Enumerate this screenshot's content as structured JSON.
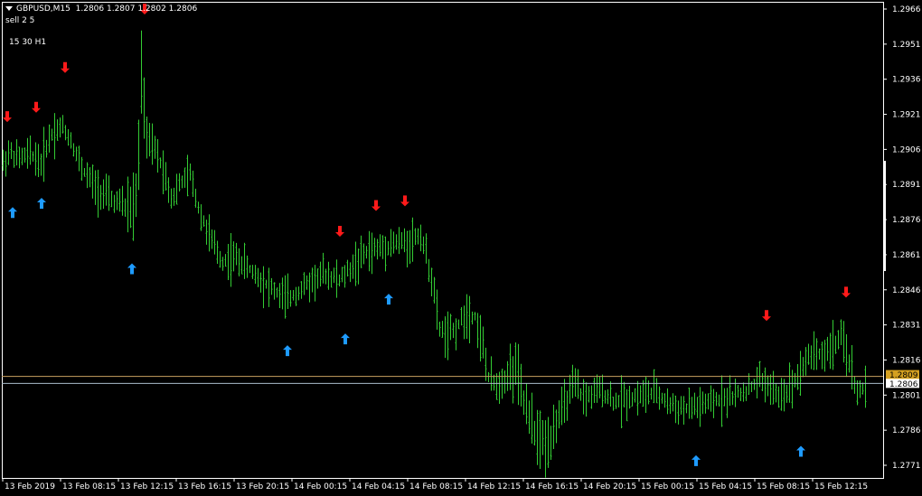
{
  "header": {
    "symbol_timeframe": "GBPUSD,M15",
    "ohlc": "1.2806 1.2807 1.2802 1.2806",
    "signal_label": "sell 2 5",
    "periods_label": "15 30 H1"
  },
  "colors": {
    "background": "#000000",
    "bars": "#33cc33",
    "buy_arrow": "#1e9bff",
    "sell_arrow": "#ff1a1a",
    "bid_line": "#aabbcc",
    "level_line": "#c8a060",
    "axis": "#ffffff"
  },
  "chart_data": {
    "type": "ohlc",
    "symbol": "GBPUSD",
    "timeframe": "M15",
    "ylim": [
      1.2765,
      1.2968
    ],
    "y_ticks": [
      "1.2966",
      "1.2951",
      "1.2936",
      "1.2921",
      "1.2906",
      "1.2891",
      "1.2876",
      "1.2861",
      "1.2846",
      "1.2831",
      "1.2816",
      "1.2801",
      "1.2786",
      "1.2771"
    ],
    "x_ticks": [
      "13 Feb 2019",
      "13 Feb 08:15",
      "13 Feb 12:15",
      "13 Feb 16:15",
      "13 Feb 20:15",
      "14 Feb 00:15",
      "14 Feb 04:15",
      "14 Feb 08:15",
      "14 Feb 12:15",
      "14 Feb 16:15",
      "14 Feb 20:15",
      "15 Feb 00:15",
      "15 Feb 04:15",
      "15 Feb 08:15",
      "15 Feb 12:15"
    ],
    "current_price": "1.2806",
    "level_price": "1.2809",
    "path": [
      [
        0,
        1.2898
      ],
      [
        10,
        1.2905
      ],
      [
        20,
        1.2902
      ],
      [
        35,
        1.2904
      ],
      [
        45,
        1.29
      ],
      [
        55,
        1.2912
      ],
      [
        68,
        1.2916
      ],
      [
        78,
        1.291
      ],
      [
        90,
        1.2898
      ],
      [
        105,
        1.289
      ],
      [
        120,
        1.2885
      ],
      [
        135,
        1.2882
      ],
      [
        145,
        1.288
      ],
      [
        152,
        1.2888
      ],
      [
        155,
        1.294
      ],
      [
        162,
        1.291
      ],
      [
        172,
        1.2905
      ],
      [
        180,
        1.2898
      ],
      [
        190,
        1.2885
      ],
      [
        200,
        1.2892
      ],
      [
        210,
        1.2895
      ],
      [
        220,
        1.288
      ],
      [
        232,
        1.2868
      ],
      [
        245,
        1.2858
      ],
      [
        260,
        1.286
      ],
      [
        275,
        1.2855
      ],
      [
        290,
        1.285
      ],
      [
        305,
        1.2845
      ],
      [
        318,
        1.2842
      ],
      [
        332,
        1.2846
      ],
      [
        345,
        1.285
      ],
      [
        360,
        1.2853
      ],
      [
        375,
        1.285
      ],
      [
        390,
        1.2856
      ],
      [
        405,
        1.2862
      ],
      [
        420,
        1.2864
      ],
      [
        435,
        1.2866
      ],
      [
        450,
        1.2866
      ],
      [
        465,
        1.287
      ],
      [
        478,
        1.285
      ],
      [
        485,
        1.283
      ],
      [
        495,
        1.2826
      ],
      [
        505,
        1.283
      ],
      [
        515,
        1.2836
      ],
      [
        525,
        1.2835
      ],
      [
        535,
        1.282
      ],
      [
        540,
        1.2808
      ],
      [
        550,
        1.2805
      ],
      [
        560,
        1.281
      ],
      [
        570,
        1.2812
      ],
      [
        578,
        1.28
      ],
      [
        585,
        1.279
      ],
      [
        595,
        1.2782
      ],
      [
        605,
        1.278
      ],
      [
        615,
        1.279
      ],
      [
        625,
        1.2798
      ],
      [
        635,
        1.2805
      ],
      [
        645,
        1.28
      ],
      [
        655,
        1.2801
      ],
      [
        665,
        1.2803
      ],
      [
        680,
        1.2798
      ],
      [
        695,
        1.28
      ],
      [
        710,
        1.2801
      ],
      [
        725,
        1.2802
      ],
      [
        740,
        1.2797
      ],
      [
        755,
        1.2795
      ],
      [
        770,
        1.2796
      ],
      [
        785,
        1.2797
      ],
      [
        800,
        1.28
      ],
      [
        815,
        1.2801
      ],
      [
        830,
        1.2804
      ],
      [
        840,
        1.2808
      ],
      [
        850,
        1.2805
      ],
      [
        860,
        1.28
      ],
      [
        870,
        1.2803
      ],
      [
        880,
        1.2808
      ],
      [
        890,
        1.2815
      ],
      [
        900,
        1.282
      ],
      [
        910,
        1.2818
      ],
      [
        920,
        1.2822
      ],
      [
        930,
        1.2825
      ],
      [
        940,
        1.2815
      ],
      [
        945,
        1.2805
      ],
      [
        952,
        1.2802
      ],
      [
        958,
        1.2806
      ]
    ],
    "buy_arrows": [
      {
        "x": 14,
        "price": 1.2879
      },
      {
        "x": 46,
        "price": 1.2883
      },
      {
        "x": 146,
        "price": 1.2855
      },
      {
        "x": 318,
        "price": 1.282
      },
      {
        "x": 382,
        "price": 1.2825
      },
      {
        "x": 430,
        "price": 1.2842
      },
      {
        "x": 770,
        "price": 1.2773
      },
      {
        "x": 886,
        "price": 1.2777
      }
    ],
    "sell_arrows": [
      {
        "x": 8,
        "price": 1.292
      },
      {
        "x": 40,
        "price": 1.2924
      },
      {
        "x": 72,
        "price": 1.2941
      },
      {
        "x": 160,
        "price": 1.2966
      },
      {
        "x": 376,
        "price": 1.2871
      },
      {
        "x": 416,
        "price": 1.2882
      },
      {
        "x": 448,
        "price": 1.2884
      },
      {
        "x": 848,
        "price": 1.2835
      },
      {
        "x": 936,
        "price": 1.2845
      }
    ]
  }
}
